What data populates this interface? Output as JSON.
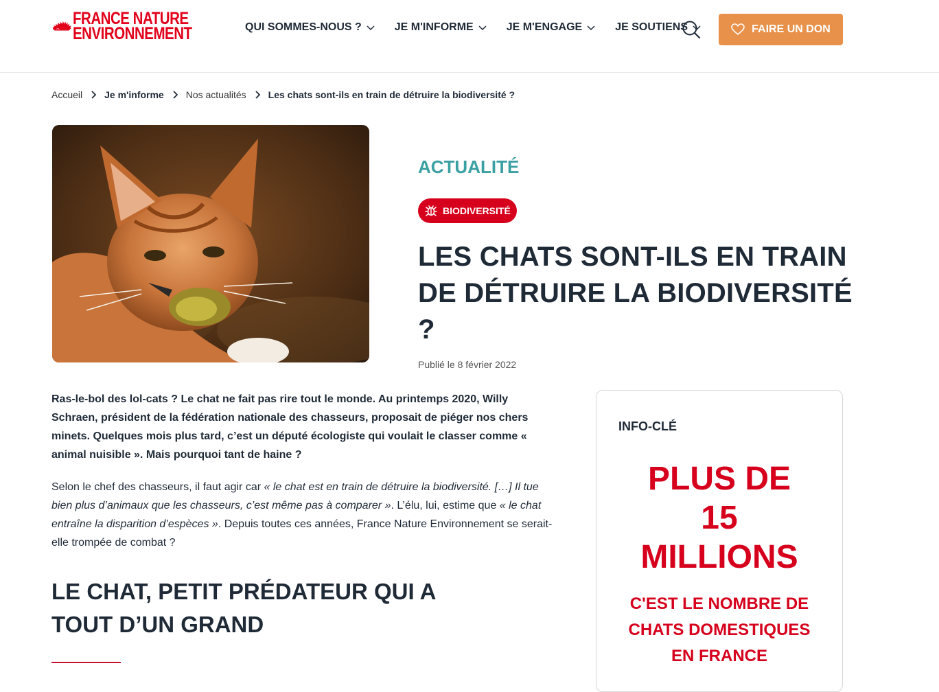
{
  "brand": {
    "line1": "FRANCE NATURE",
    "line2": "ENVIRONNEMENT",
    "color": "#e2001a"
  },
  "nav": {
    "items": [
      {
        "label": "QUI SOMMES-NOUS ?"
      },
      {
        "label": "JE M'INFORME"
      },
      {
        "label": "JE M'ENGAGE"
      },
      {
        "label": "JE SOUTIENS"
      }
    ],
    "donate_label": "FAIRE UN DON",
    "accent": "#e8914a"
  },
  "breadcrumb": {
    "items": [
      "Accueil",
      "Je m'informe",
      "Nos actualités",
      "Les chats sont-ils en train de détruire la biodiversité ?"
    ]
  },
  "hero": {
    "kicker": "ACTUALITÉ",
    "tag": "BIODIVERSITÉ",
    "title": "LES CHATS SONT-ILS EN TRAIN DE DÉTRUIRE LA BIODIVERSITÉ ?",
    "date": "Publié le 8 février 2022"
  },
  "article": {
    "lead": "Ras-le-bol des lol-cats ? Le chat ne fait pas rire tout le monde. Au printemps 2020, Willy Schraen, président de la fédération nationale des chasseurs, proposait de piéger nos chers minets. Quelques mois plus tard, c’est un député écologiste qui voulait le classer comme « animal nuisible ». Mais pourquoi tant de haine ?",
    "p1_a": "Selon le chef des chasseurs, il faut agir car ",
    "p1_b": "« le chat est en train de détruire la biodiversité. […] Il tue bien plus d’animaux que les chasseurs, c’est même pas à comparer »",
    "p1_c": ". L’élu, lui, estime que ",
    "p1_d": "« le chat entraîne la disparition d’espèces »",
    "p1_e": ". Depuis toutes ces années, France Nature Environnement se serait-elle trompée de combat ?",
    "h2": "LE CHAT, PETIT PRÉDATEUR QUI A TOUT D’UN GRAND"
  },
  "keyinfo": {
    "label": "INFO-CLÉ",
    "figure_l1": "PLUS DE",
    "figure_l2": "15",
    "figure_l3": "MILLIONS",
    "desc_l1": "C'EST LE NOMBRE DE",
    "desc_l2": "CHATS DOMESTIQUES",
    "desc_l3": "EN FRANCE",
    "color": "#d6001c"
  },
  "icons": [
    "hedgehog-logo-icon",
    "chevron-down-icon",
    "search-icon",
    "heart-icon",
    "chevron-right-icon",
    "bug-icon",
    "cat-photo"
  ]
}
